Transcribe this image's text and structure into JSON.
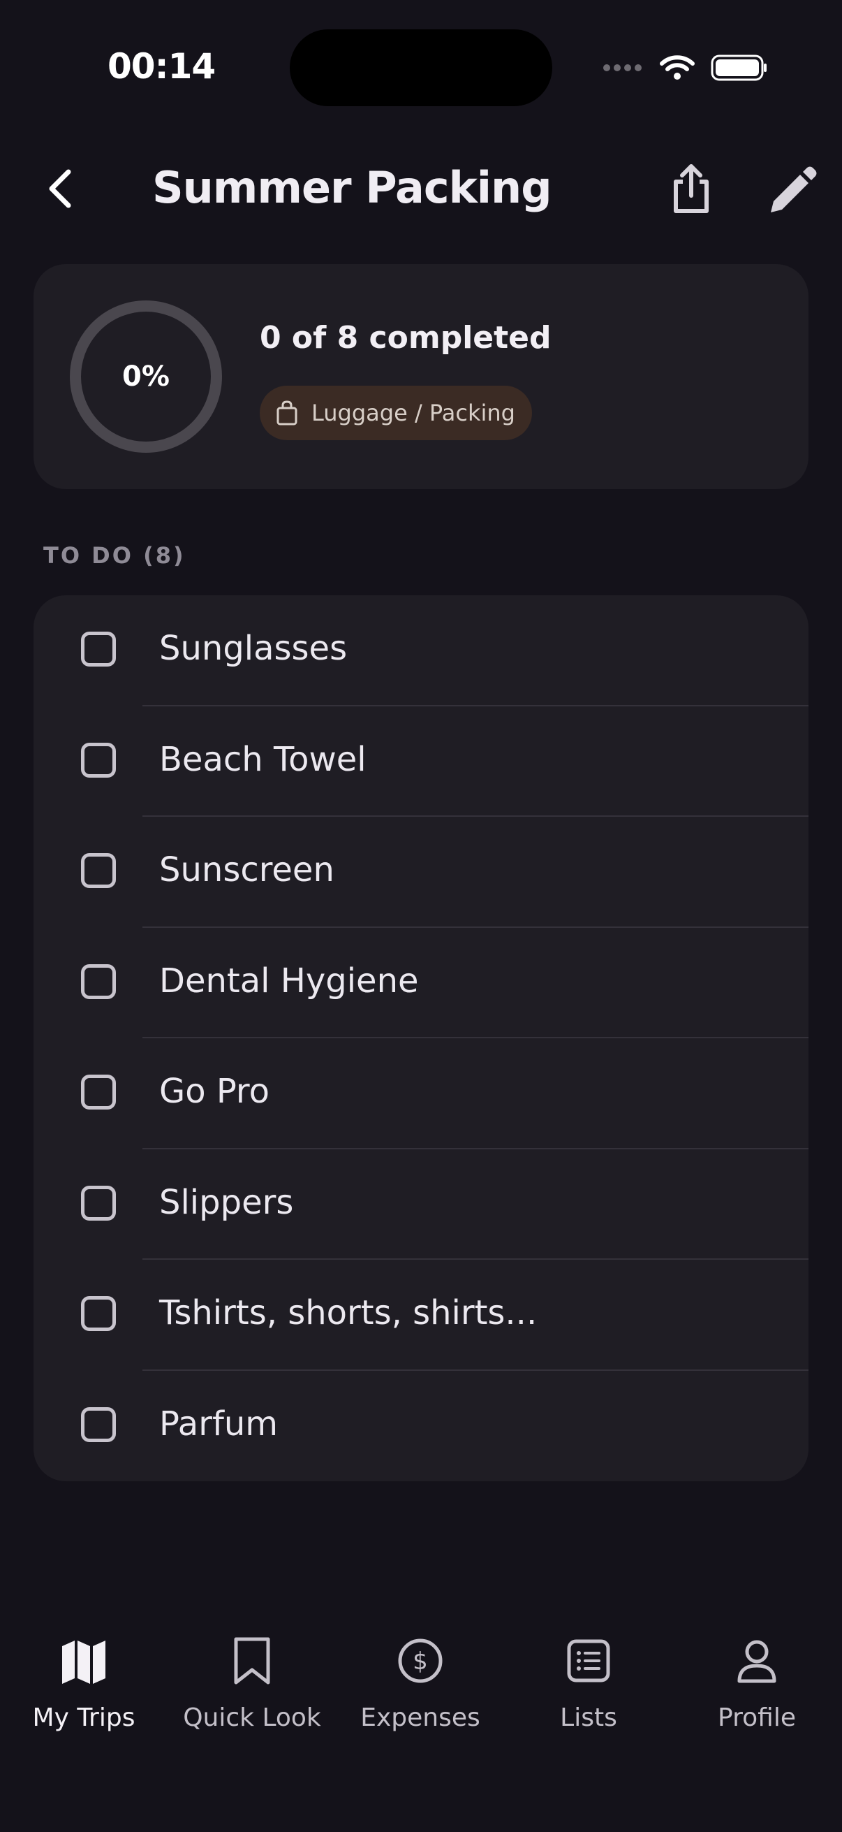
{
  "status": {
    "time": "00:14"
  },
  "header": {
    "title": "Summer Packing"
  },
  "summary": {
    "percent": "0%",
    "progress": 0,
    "completed": "0 of 8 completed",
    "category": "Luggage / Packing"
  },
  "section": {
    "label": "TO DO (8)"
  },
  "items": [
    {
      "label": "Sunglasses",
      "checked": false
    },
    {
      "label": "Beach Towel",
      "checked": false
    },
    {
      "label": "Sunscreen",
      "checked": false
    },
    {
      "label": "Dental Hygiene",
      "checked": false
    },
    {
      "label": "Go Pro",
      "checked": false
    },
    {
      "label": "Slippers",
      "checked": false
    },
    {
      "label": "Tshirts, shorts, shirts...",
      "checked": false
    },
    {
      "label": "Parfum",
      "checked": false
    }
  ],
  "tabs": [
    {
      "label": "My Trips",
      "icon": "map-icon",
      "active": true
    },
    {
      "label": "Quick Look",
      "icon": "bookmark-icon",
      "active": false
    },
    {
      "label": "Expenses",
      "icon": "dollar-circle-icon",
      "active": false
    },
    {
      "label": "Lists",
      "icon": "list-icon",
      "active": false
    },
    {
      "label": "Profile",
      "icon": "person-icon",
      "active": false
    }
  ],
  "colors": {
    "background": "#14121a",
    "card": "#1f1d24",
    "badge": "#3b2b24",
    "ring_track": "#4a474e"
  }
}
